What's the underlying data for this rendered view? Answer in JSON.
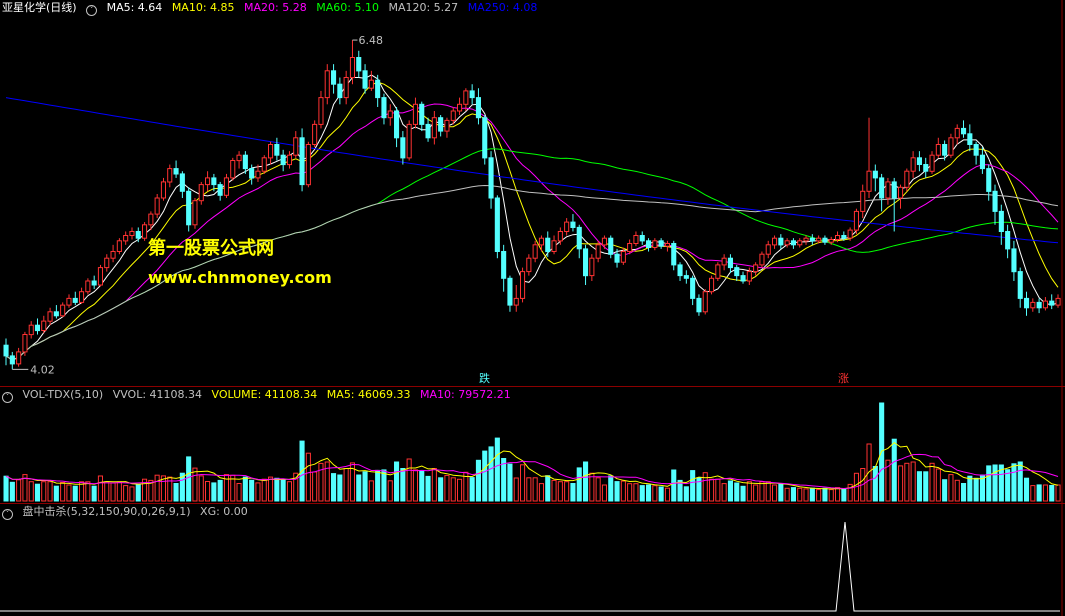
{
  "price_pane": {
    "title": "亚星化学(日线)",
    "ma_labels": [
      {
        "text": "MA5: 4.64",
        "color": "#ffffff"
      },
      {
        "text": "MA10: 4.85",
        "color": "#ffff00"
      },
      {
        "text": "MA20: 5.28",
        "color": "#ff00ff"
      },
      {
        "text": "MA60: 5.10",
        "color": "#00ff00"
      },
      {
        "text": "MA120: 5.27",
        "color": "#c0c0c0"
      },
      {
        "text": "MA250: 4.08",
        "color": "#0000ff"
      }
    ],
    "high_label": "6.48",
    "low_label": "4.02",
    "watermark_title": "第一股票公式网",
    "watermark_url": "www.chnmoney.com",
    "signal_down": "跌",
    "signal_up": "涨",
    "colors": {
      "up": "#ff3232",
      "down": "#54ffff",
      "bg": "#000000",
      "separator": "#8b0000"
    }
  },
  "volume_pane": {
    "labels": [
      {
        "text": "VOL-TDX(5,10)",
        "color": "#c0c0c0"
      },
      {
        "text": "VVOL: 41108.34",
        "color": "#c0c0c0"
      },
      {
        "text": "VOLUME: 41108.34",
        "color": "#ffff00"
      },
      {
        "text": "MA5: 46069.33",
        "color": "#ffff00"
      },
      {
        "text": "MA10: 79572.21",
        "color": "#ff00ff"
      }
    ]
  },
  "indicator_pane": {
    "labels": [
      {
        "text": "盘中击杀(5,32,150,90,0,26,9,1)",
        "color": "#c0c0c0"
      },
      {
        "text": "XG: 0.00",
        "color": "#c0c0c0"
      }
    ]
  },
  "chart_data": {
    "type": "candlestick",
    "price_ylim": [
      4.0,
      6.6
    ],
    "candles": [
      [
        4.2,
        4.12,
        4.25,
        4.05
      ],
      [
        4.12,
        4.06,
        4.15,
        4.02
      ],
      [
        4.06,
        4.15,
        4.18,
        4.04
      ],
      [
        4.15,
        4.28,
        4.3,
        4.12
      ],
      [
        4.28,
        4.35,
        4.38,
        4.25
      ],
      [
        4.35,
        4.31,
        4.4,
        4.28
      ],
      [
        4.31,
        4.38,
        4.42,
        4.29
      ],
      [
        4.38,
        4.45,
        4.48,
        4.35
      ],
      [
        4.45,
        4.42,
        4.5,
        4.4
      ],
      [
        4.42,
        4.5,
        4.52,
        4.41
      ],
      [
        4.5,
        4.55,
        4.58,
        4.48
      ],
      [
        4.55,
        4.52,
        4.6,
        4.5
      ],
      [
        4.52,
        4.6,
        4.63,
        4.51
      ],
      [
        4.6,
        4.68,
        4.7,
        4.58
      ],
      [
        4.68,
        4.65,
        4.72,
        4.62
      ],
      [
        4.65,
        4.78,
        4.8,
        4.64
      ],
      [
        4.78,
        4.85,
        4.88,
        4.75
      ],
      [
        4.85,
        4.9,
        4.95,
        4.82
      ],
      [
        4.9,
        4.98,
        5.0,
        4.88
      ],
      [
        4.98,
        5.02,
        5.05,
        4.95
      ],
      [
        5.02,
        5.05,
        5.08,
        4.99
      ],
      [
        5.05,
        5.0,
        5.08,
        4.97
      ],
      [
        5.0,
        5.1,
        5.12,
        4.98
      ],
      [
        5.1,
        5.18,
        5.2,
        5.06
      ],
      [
        5.18,
        5.3,
        5.33,
        5.15
      ],
      [
        5.3,
        5.42,
        5.45,
        5.28
      ],
      [
        5.42,
        5.52,
        5.55,
        5.38
      ],
      [
        5.52,
        5.48,
        5.58,
        5.45
      ],
      [
        5.48,
        5.35,
        5.5,
        5.3
      ],
      [
        5.35,
        5.1,
        5.38,
        5.05
      ],
      [
        5.1,
        5.28,
        5.3,
        5.07
      ],
      [
        5.28,
        5.4,
        5.42,
        5.25
      ],
      [
        5.4,
        5.45,
        5.5,
        5.35
      ],
      [
        5.45,
        5.4,
        5.48,
        5.35
      ],
      [
        5.4,
        5.32,
        5.42,
        5.28
      ],
      [
        5.32,
        5.45,
        5.48,
        5.3
      ],
      [
        5.45,
        5.58,
        5.6,
        5.43
      ],
      [
        5.58,
        5.62,
        5.65,
        5.52
      ],
      [
        5.62,
        5.52,
        5.65,
        5.48
      ],
      [
        5.52,
        5.45,
        5.55,
        5.4
      ],
      [
        5.45,
        5.5,
        5.55,
        5.42
      ],
      [
        5.5,
        5.6,
        5.62,
        5.48
      ],
      [
        5.6,
        5.7,
        5.72,
        5.55
      ],
      [
        5.7,
        5.62,
        5.75,
        5.58
      ],
      [
        5.62,
        5.55,
        5.66,
        5.5
      ],
      [
        5.55,
        5.62,
        5.65,
        5.52
      ],
      [
        5.62,
        5.75,
        5.8,
        5.6
      ],
      [
        5.75,
        5.4,
        5.82,
        5.35
      ],
      [
        5.4,
        5.7,
        5.72,
        5.38
      ],
      [
        5.7,
        5.85,
        5.88,
        5.68
      ],
      [
        5.85,
        6.05,
        6.1,
        5.82
      ],
      [
        6.05,
        6.25,
        6.3,
        6.0
      ],
      [
        6.25,
        6.15,
        6.3,
        6.08
      ],
      [
        6.15,
        6.05,
        6.2,
        6.0
      ],
      [
        6.05,
        6.2,
        6.25,
        6.0
      ],
      [
        6.2,
        6.35,
        6.48,
        6.15
      ],
      [
        6.35,
        6.25,
        6.4,
        6.2
      ],
      [
        6.25,
        6.12,
        6.3,
        6.08
      ],
      [
        6.12,
        6.18,
        6.25,
        6.1
      ],
      [
        6.18,
        6.05,
        6.22,
        5.98
      ],
      [
        6.05,
        5.9,
        6.08,
        5.85
      ],
      [
        5.9,
        5.95,
        6.0,
        5.84
      ],
      [
        5.95,
        5.75,
        5.98,
        5.68
      ],
      [
        5.75,
        5.6,
        5.8,
        5.55
      ],
      [
        5.6,
        5.85,
        5.88,
        5.58
      ],
      [
        5.85,
        6.0,
        6.05,
        5.82
      ],
      [
        6.0,
        5.85,
        6.02,
        5.8
      ],
      [
        5.85,
        5.75,
        5.9,
        5.72
      ],
      [
        5.75,
        5.9,
        5.95,
        5.7
      ],
      [
        5.9,
        5.8,
        5.92,
        5.76
      ],
      [
        5.8,
        5.88,
        5.9,
        5.75
      ],
      [
        5.88,
        5.95,
        5.98,
        5.85
      ],
      [
        5.95,
        6.0,
        6.05,
        5.92
      ],
      [
        6.0,
        6.1,
        6.12,
        5.95
      ],
      [
        6.1,
        6.05,
        6.15,
        6.0
      ],
      [
        6.05,
        5.9,
        6.12,
        5.85
      ],
      [
        5.9,
        5.6,
        5.92,
        5.55
      ],
      [
        5.6,
        5.3,
        5.65,
        5.22
      ],
      [
        5.3,
        4.9,
        5.32,
        4.85
      ],
      [
        4.9,
        4.7,
        4.95,
        4.6
      ],
      [
        4.7,
        4.5,
        4.72,
        4.45
      ],
      [
        4.5,
        4.55,
        4.65,
        4.45
      ],
      [
        4.55,
        4.75,
        4.78,
        4.52
      ],
      [
        4.75,
        4.85,
        4.88,
        4.72
      ],
      [
        4.85,
        4.95,
        4.98,
        4.82
      ],
      [
        4.95,
        5.0,
        5.02,
        4.9
      ],
      [
        5.0,
        4.9,
        5.05,
        4.86
      ],
      [
        4.9,
        4.98,
        5.02,
        4.88
      ],
      [
        4.98,
        5.05,
        5.08,
        4.95
      ],
      [
        5.05,
        5.12,
        5.15,
        5.02
      ],
      [
        5.12,
        5.08,
        5.18,
        5.05
      ],
      [
        5.08,
        4.92,
        5.1,
        4.85
      ],
      [
        4.92,
        4.72,
        4.95,
        4.65
      ],
      [
        4.72,
        4.85,
        4.88,
        4.68
      ],
      [
        4.85,
        4.95,
        4.98,
        4.82
      ],
      [
        4.95,
        5.0,
        5.02,
        4.92
      ],
      [
        5.0,
        4.88,
        5.02,
        4.85
      ],
      [
        4.88,
        4.82,
        4.92,
        4.78
      ],
      [
        4.82,
        4.9,
        4.93,
        4.8
      ],
      [
        4.9,
        4.96,
        4.99,
        4.88
      ],
      [
        4.96,
        5.02,
        5.05,
        4.94
      ],
      [
        5.02,
        4.98,
        5.05,
        4.95
      ],
      [
        4.98,
        4.93,
        5.0,
        4.9
      ],
      [
        4.93,
        4.98,
        5.0,
        4.91
      ],
      [
        4.98,
        4.94,
        5.0,
        4.92
      ],
      [
        4.94,
        4.96,
        4.98,
        4.9
      ],
      [
        4.96,
        4.8,
        4.98,
        4.76
      ],
      [
        4.8,
        4.72,
        4.82,
        4.68
      ],
      [
        4.72,
        4.7,
        4.76,
        4.66
      ],
      [
        4.7,
        4.55,
        4.72,
        4.5
      ],
      [
        4.55,
        4.45,
        4.58,
        4.42
      ],
      [
        4.45,
        4.6,
        4.62,
        4.43
      ],
      [
        4.6,
        4.7,
        4.72,
        4.58
      ],
      [
        4.7,
        4.8,
        4.82,
        4.68
      ],
      [
        4.8,
        4.85,
        4.88,
        4.76
      ],
      [
        4.85,
        4.78,
        4.88,
        4.74
      ],
      [
        4.78,
        4.72,
        4.8,
        4.68
      ],
      [
        4.72,
        4.68,
        4.75,
        4.66
      ],
      [
        4.68,
        4.75,
        4.78,
        4.65
      ],
      [
        4.75,
        4.8,
        4.82,
        4.72
      ],
      [
        4.8,
        4.88,
        4.9,
        4.78
      ],
      [
        4.88,
        4.95,
        4.98,
        4.85
      ],
      [
        4.95,
        5.0,
        5.02,
        4.92
      ],
      [
        5.0,
        4.95,
        5.03,
        4.92
      ],
      [
        4.95,
        4.98,
        5.0,
        4.93
      ],
      [
        4.98,
        4.95,
        5.0,
        4.92
      ],
      [
        4.95,
        4.98,
        5.0,
        4.93
      ],
      [
        4.98,
        5.0,
        5.02,
        4.95
      ],
      [
        5.0,
        4.98,
        5.03,
        4.95
      ],
      [
        4.98,
        5.0,
        5.02,
        4.96
      ],
      [
        5.0,
        4.97,
        5.02,
        4.95
      ],
      [
        4.97,
        4.99,
        5.01,
        4.95
      ],
      [
        4.99,
        5.02,
        5.05,
        4.97
      ],
      [
        5.02,
        5.0,
        5.05,
        4.98
      ],
      [
        5.0,
        5.06,
        5.08,
        4.98
      ],
      [
        5.06,
        5.2,
        5.22,
        5.03
      ],
      [
        5.2,
        5.35,
        5.4,
        5.15
      ],
      [
        5.35,
        5.5,
        5.9,
        5.3
      ],
      [
        5.5,
        5.45,
        5.55,
        5.35
      ],
      [
        5.45,
        5.3,
        5.48,
        5.2
      ],
      [
        5.3,
        5.42,
        5.45,
        5.25
      ],
      [
        5.42,
        5.3,
        5.45,
        5.05
      ],
      [
        5.3,
        5.38,
        5.4,
        5.22
      ],
      [
        5.38,
        5.5,
        5.52,
        5.35
      ],
      [
        5.5,
        5.6,
        5.65,
        5.45
      ],
      [
        5.6,
        5.55,
        5.65,
        5.5
      ],
      [
        5.55,
        5.5,
        5.6,
        5.45
      ],
      [
        5.5,
        5.62,
        5.65,
        5.48
      ],
      [
        5.62,
        5.7,
        5.75,
        5.6
      ],
      [
        5.7,
        5.62,
        5.73,
        5.58
      ],
      [
        5.62,
        5.75,
        5.78,
        5.6
      ],
      [
        5.75,
        5.82,
        5.85,
        5.7
      ],
      [
        5.82,
        5.78,
        5.88,
        5.75
      ],
      [
        5.78,
        5.7,
        5.85,
        5.65
      ],
      [
        5.7,
        5.62,
        5.72,
        5.55
      ],
      [
        5.62,
        5.52,
        5.68,
        5.48
      ],
      [
        5.52,
        5.35,
        5.55,
        5.28
      ],
      [
        5.35,
        5.2,
        5.4,
        5.1
      ],
      [
        5.2,
        5.05,
        5.25,
        4.95
      ],
      [
        5.05,
        4.92,
        5.1,
        4.85
      ],
      [
        4.92,
        4.75,
        4.98,
        4.68
      ],
      [
        4.75,
        4.55,
        4.78,
        4.48
      ],
      [
        4.55,
        4.48,
        4.6,
        4.42
      ],
      [
        4.48,
        4.52,
        4.55,
        4.45
      ],
      [
        4.52,
        4.48,
        4.55,
        4.44
      ],
      [
        4.48,
        4.53,
        4.56,
        4.46
      ],
      [
        4.53,
        4.5,
        4.58,
        4.47
      ],
      [
        4.5,
        4.55,
        4.58,
        4.48
      ]
    ]
  }
}
